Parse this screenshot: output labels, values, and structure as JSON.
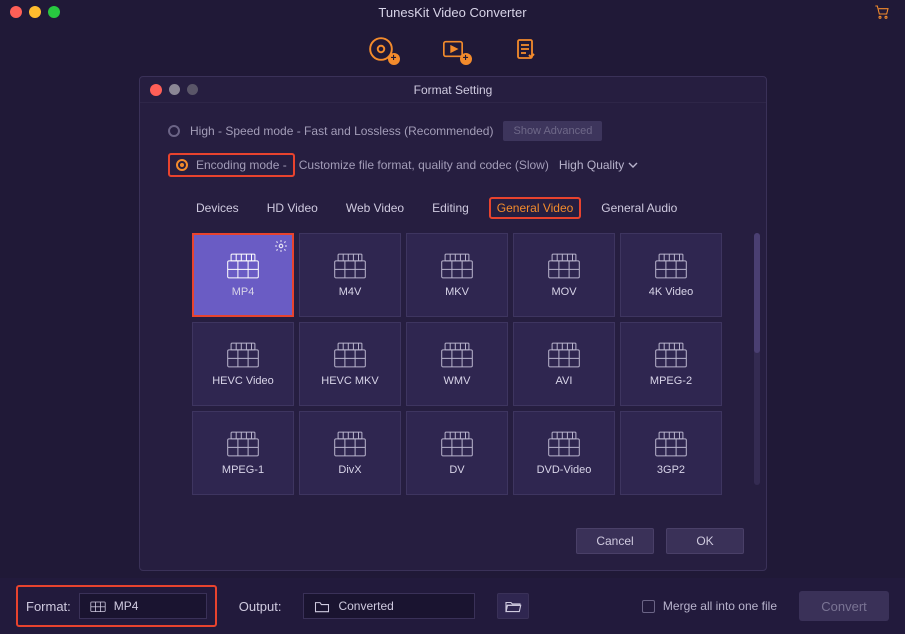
{
  "app": {
    "title": "TunesKit Video Converter"
  },
  "modal": {
    "title": "Format Setting",
    "mode1": "High - Speed mode - Fast and Lossless (Recommended)",
    "mode2_prefix": "Encoding mode - ",
    "mode2_rest": "Customize file format, quality and codec (Slow)",
    "advanced": "Show Advanced",
    "quality": "High Quality"
  },
  "tabs": {
    "t1": "Devices",
    "t2": "HD Video",
    "t3": "Web Video",
    "t4": "Editing",
    "t5": "General Video",
    "t6": "General Audio"
  },
  "formats": {
    "r1c1": "MP4",
    "r1c2": "M4V",
    "r1c3": "MKV",
    "r1c4": "MOV",
    "r1c5": "4K Video",
    "r2c1": "HEVC Video",
    "r2c2": "HEVC MKV",
    "r2c3": "WMV",
    "r2c4": "AVI",
    "r2c5": "MPEG-2",
    "r3c1": "MPEG-1",
    "r3c2": "DivX",
    "r3c3": "DV",
    "r3c4": "DVD-Video",
    "r3c5": "3GP2"
  },
  "buttons": {
    "cancel": "Cancel",
    "ok": "OK",
    "convert": "Convert"
  },
  "bottom": {
    "format_label": "Format:",
    "format_value": "MP4",
    "output_label": "Output:",
    "output_value": "Converted",
    "merge": "Merge all into one file"
  }
}
